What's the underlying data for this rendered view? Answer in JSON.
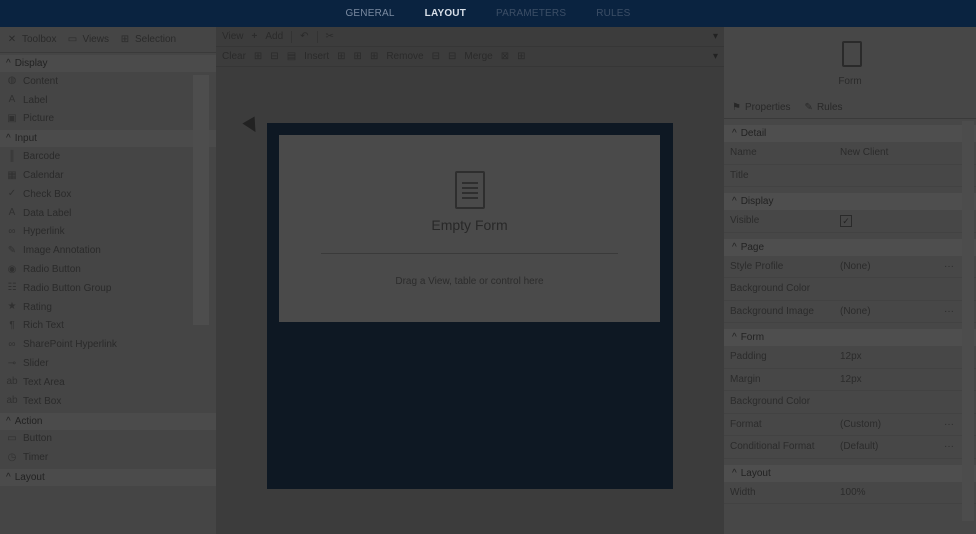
{
  "topbar": {
    "tabs": [
      "GENERAL",
      "LAYOUT",
      "PARAMETERS",
      "RULES"
    ]
  },
  "left": {
    "toolbar": [
      {
        "label": "Toolbox",
        "icon": "toolbox-icon"
      },
      {
        "label": "Views",
        "icon": "views-icon"
      },
      {
        "label": "Selection",
        "icon": "selection-icon"
      }
    ],
    "sections": [
      {
        "title": "Display",
        "items": [
          "Content",
          "Label",
          "Picture"
        ]
      },
      {
        "title": "Input",
        "items": [
          "Barcode",
          "Calendar",
          "Check Box",
          "Data Label",
          "Hyperlink",
          "Image Annotation",
          "Radio Button",
          "Radio Button Group",
          "Rating",
          "Rich Text",
          "SharePoint Hyperlink",
          "Slider",
          "Text Area",
          "Text Box"
        ]
      },
      {
        "title": "Action",
        "items": [
          "Button",
          "Timer"
        ]
      },
      {
        "title": "Layout",
        "items": []
      }
    ]
  },
  "center": {
    "toolbar1": {
      "view": "View",
      "add": "Add"
    },
    "toolbar2": {
      "clear": "Clear",
      "insert": "Insert",
      "remove": "Remove",
      "merge": "Merge"
    },
    "form": {
      "title": "Empty Form",
      "hint": "Drag a View, table or control here"
    }
  },
  "right": {
    "header": {
      "label": "Form"
    },
    "tabs": {
      "properties": "Properties",
      "rules": "Rules"
    },
    "detail": {
      "title": "Detail",
      "rows": [
        {
          "k": "Name",
          "v": "New Client"
        },
        {
          "k": "Title",
          "v": ""
        }
      ]
    },
    "display": {
      "title": "Display",
      "visible_label": "Visible",
      "visible_checked": "✓"
    },
    "page": {
      "title": "Page",
      "rows": [
        {
          "k": "Style Profile",
          "v": "(None)"
        },
        {
          "k": "Background Color",
          "v": ""
        },
        {
          "k": "Background Image",
          "v": "(None)"
        }
      ]
    },
    "form": {
      "title": "Form",
      "rows": [
        {
          "k": "Padding",
          "v": "12px"
        },
        {
          "k": "Margin",
          "v": "12px"
        },
        {
          "k": "Background Color",
          "v": ""
        },
        {
          "k": "Format",
          "v": "(Custom)"
        },
        {
          "k": "Conditional Format",
          "v": "(Default)"
        }
      ]
    },
    "layout": {
      "title": "Layout",
      "rows": [
        {
          "k": "Width",
          "v": "100%"
        }
      ]
    },
    "ellipsis": "···"
  },
  "colors": {
    "topbar": "#0a2340",
    "canvas": "#0e1823",
    "panel": "#474747"
  }
}
